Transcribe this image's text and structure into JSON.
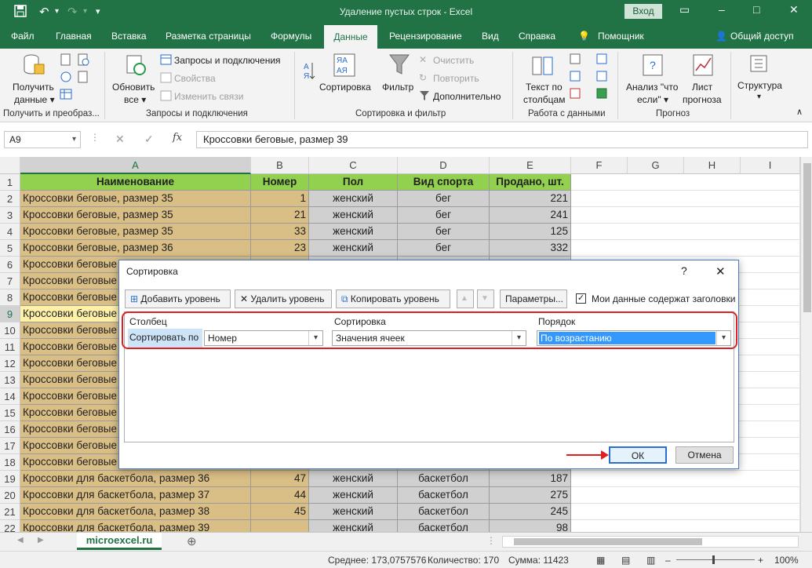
{
  "titlebar": {
    "title": "Удаление пустых строк  -  Excel",
    "login": "Вход",
    "minimize": "–",
    "restore": "□",
    "close": "✕",
    "ribbon_opts": "▭"
  },
  "tabs": [
    "Файл",
    "Главная",
    "Вставка",
    "Разметка страницы",
    "Формулы",
    "Данные",
    "Рецензирование",
    "Вид",
    "Справка",
    "Помощник",
    "Общий доступ"
  ],
  "ribbon": {
    "get_data": {
      "line1": "Получить",
      "line2": "данные ▾"
    },
    "group1_label": "Получить и преобраз...",
    "refresh": {
      "line1": "Обновить",
      "line2": "все ▾"
    },
    "queries": "Запросы и подключения",
    "properties": "Свойства",
    "edit_links": "Изменить связи",
    "group2_label": "Запросы и подключения",
    "sort": "Сортировка",
    "filter": "Фильтр",
    "clear": "Очистить",
    "reapply": "Повторить",
    "advanced": "Дополнительно",
    "group3_label": "Сортировка и фильтр",
    "text_to_cols": {
      "line1": "Текст по",
      "line2": "столбцам"
    },
    "group4_label": "Работа с данными",
    "whatif": {
      "line1": "Анализ \"что",
      "line2": "если\" ▾"
    },
    "forecast": {
      "line1": "Лист",
      "line2": "прогноза"
    },
    "group5_label": "Прогноз",
    "outline": "Структура",
    "outline_arrow": "▾",
    "collapse": "∧"
  },
  "formula_bar": {
    "name": "A9",
    "formula": "Кроссовки беговые, размер 39",
    "fx": "fx",
    "cancel": "✕",
    "enter": "✓",
    "name_arrow": "▾",
    "dots": "⋮"
  },
  "columns": [
    "A",
    "B",
    "C",
    "D",
    "E",
    "F",
    "G",
    "H",
    "I"
  ],
  "header_row": [
    "Наименование",
    "Номер",
    "Пол",
    "Вид спорта",
    "Продано, шт."
  ],
  "rows": [
    {
      "n": "2",
      "a": "Кроссовки беговые, размер 35",
      "b": "1",
      "c": "женский",
      "d": "бег",
      "e": "221"
    },
    {
      "n": "3",
      "a": "Кроссовки беговые, размер 35",
      "b": "21",
      "c": "женский",
      "d": "бег",
      "e": "241"
    },
    {
      "n": "4",
      "a": "Кроссовки беговые, размер 35",
      "b": "33",
      "c": "женский",
      "d": "бег",
      "e": "125"
    },
    {
      "n": "5",
      "a": "Кроссовки беговые, размер 36",
      "b": "23",
      "c": "женский",
      "d": "бег",
      "e": "332"
    },
    {
      "n": "6",
      "a": "Кроссовки беговые",
      "b": "",
      "c": "",
      "d": "",
      "e": ""
    },
    {
      "n": "7",
      "a": "Кроссовки беговые",
      "b": "",
      "c": "",
      "d": "",
      "e": ""
    },
    {
      "n": "8",
      "a": "Кроссовки беговые",
      "b": "",
      "c": "",
      "d": "",
      "e": ""
    },
    {
      "n": "9",
      "a": "Кроссовки беговые",
      "b": "",
      "c": "",
      "d": "",
      "e": ""
    },
    {
      "n": "10",
      "a": "Кроссовки беговые",
      "b": "",
      "c": "",
      "d": "",
      "e": ""
    },
    {
      "n": "11",
      "a": "Кроссовки беговые",
      "b": "",
      "c": "",
      "d": "",
      "e": ""
    },
    {
      "n": "12",
      "a": "Кроссовки беговые",
      "b": "",
      "c": "",
      "d": "",
      "e": ""
    },
    {
      "n": "13",
      "a": "Кроссовки беговые",
      "b": "",
      "c": "",
      "d": "",
      "e": ""
    },
    {
      "n": "14",
      "a": "Кроссовки беговые",
      "b": "",
      "c": "",
      "d": "",
      "e": ""
    },
    {
      "n": "15",
      "a": "Кроссовки беговые",
      "b": "",
      "c": "",
      "d": "",
      "e": ""
    },
    {
      "n": "16",
      "a": "Кроссовки беговые",
      "b": "",
      "c": "",
      "d": "",
      "e": ""
    },
    {
      "n": "17",
      "a": "Кроссовки беговые",
      "b": "",
      "c": "",
      "d": "",
      "e": ""
    },
    {
      "n": "18",
      "a": "Кроссовки беговые",
      "b": "",
      "c": "",
      "d": "",
      "e": ""
    },
    {
      "n": "19",
      "a": "Кроссовки для баскетбола, размер 36",
      "b": "47",
      "c": "женский",
      "d": "баскетбол",
      "e": "187"
    },
    {
      "n": "20",
      "a": "Кроссовки для баскетбола, размер 37",
      "b": "44",
      "c": "женский",
      "d": "баскетбол",
      "e": "275"
    },
    {
      "n": "21",
      "a": "Кроссовки для баскетбола, размер 38",
      "b": "45",
      "c": "женский",
      "d": "баскетбол",
      "e": "245"
    },
    {
      "n": "22",
      "a": "Кроссовки для баскетбола, размер 39",
      "b": "",
      "c": "женский",
      "d": "баскетбол",
      "e": "98"
    }
  ],
  "sheet": {
    "name": "microexcel.ru",
    "add": "⊕",
    "prev": "◀",
    "next": "▶",
    "dots": "⋮"
  },
  "status": {
    "avg": "Среднее: 173,0757576",
    "count": "Количество: 170",
    "sum": "Сумма: 11423",
    "zoom": "100%",
    "minus": "–",
    "plus": "+"
  },
  "dialog": {
    "title": "Сортировка",
    "help": "?",
    "close": "✕",
    "add_level": "Добавить уровень",
    "delete_level": "Удалить уровень",
    "copy_level": "Копировать уровень",
    "up": "▲",
    "down": "▼",
    "params": "Параметры...",
    "headers_check": "Мои данные содержат заголовки",
    "col_column": "Столбец",
    "col_sort": "Сортировка",
    "col_order": "Порядок",
    "sort_by": "Сортировать по",
    "column_value": "Номер",
    "sort_on_value": "Значения ячеек",
    "order_value": "По возрастанию",
    "ok": "ОК",
    "cancel": "Отмена"
  }
}
